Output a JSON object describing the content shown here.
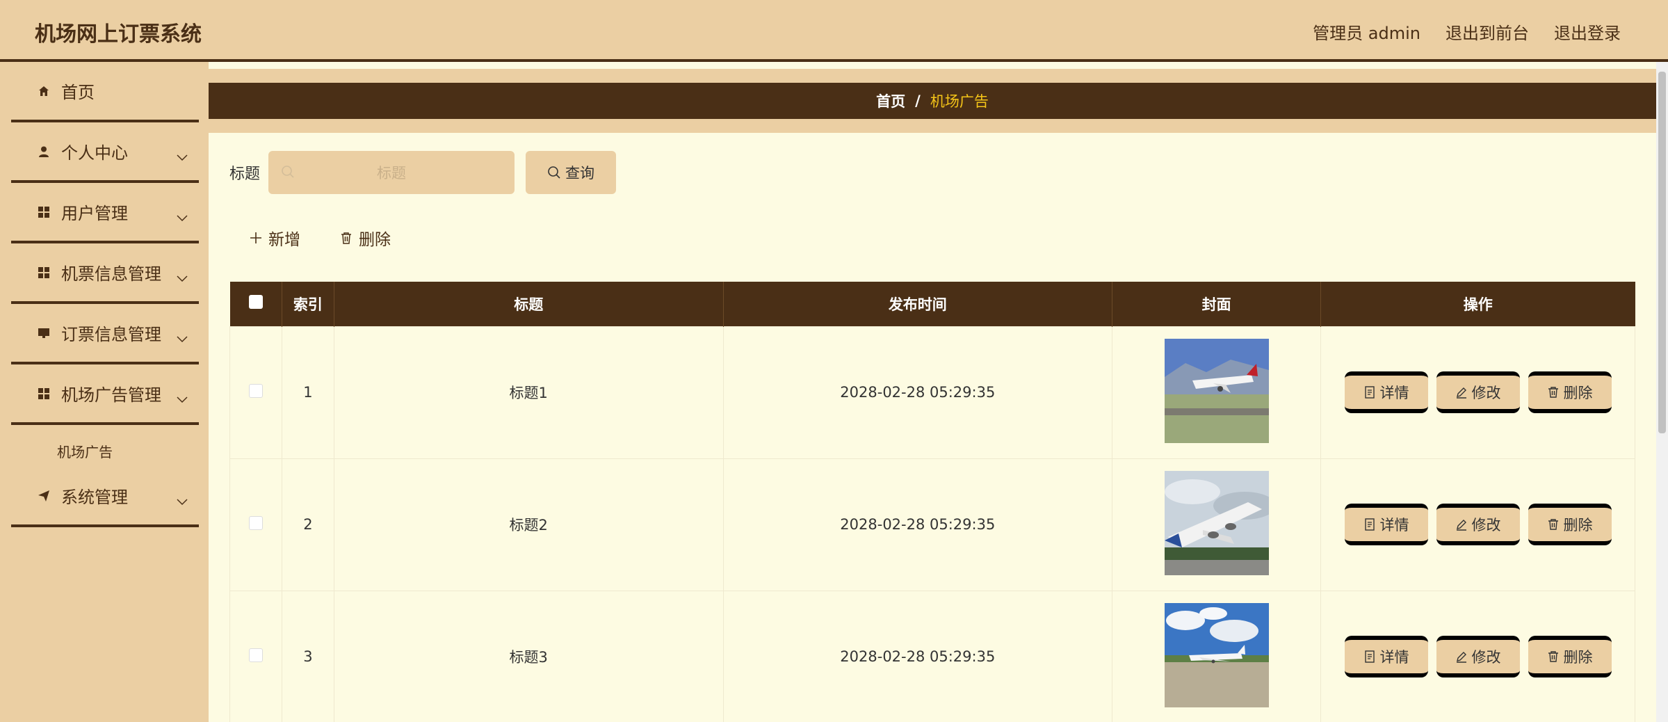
{
  "app": {
    "title": "机场网上订票系统"
  },
  "top_links": {
    "admin": "管理员 admin",
    "to_front": "退出到前台",
    "logout": "退出登录"
  },
  "sidebar": {
    "items": [
      {
        "label": "首页",
        "icon": "home-icon"
      },
      {
        "label": "个人中心",
        "icon": "user-icon"
      },
      {
        "label": "用户管理",
        "icon": "grid-icon"
      },
      {
        "label": "机票信息管理",
        "icon": "grid-icon"
      },
      {
        "label": "订票信息管理",
        "icon": "monitor-icon"
      },
      {
        "label": "机场广告管理",
        "icon": "grid-icon"
      },
      {
        "label": "系统管理",
        "icon": "send-icon"
      }
    ],
    "sub_item": "机场广告"
  },
  "breadcrumb": {
    "home": "首页",
    "sep": "/",
    "current": "机场广告"
  },
  "search": {
    "label": "标题",
    "placeholder": "标题",
    "button": "查询"
  },
  "actions": {
    "add": "新增",
    "delete": "删除"
  },
  "table": {
    "headers": [
      "索引",
      "标题",
      "发布时间",
      "封面",
      "操作"
    ],
    "rows": [
      {
        "index": "1",
        "title": "标题1",
        "time": "2028-02-28 05:29:35"
      },
      {
        "index": "2",
        "title": "标题2",
        "time": "2028-02-28 05:29:35"
      },
      {
        "index": "3",
        "title": "标题3",
        "time": "2028-02-28 05:29:35"
      }
    ],
    "ops": {
      "detail": "详情",
      "edit": "修改",
      "delete": "删除"
    }
  },
  "colors": {
    "accent": "#4a2f16",
    "panel": "#ebcfa3",
    "background": "#fdfbe2",
    "highlight": "#f5c518"
  }
}
